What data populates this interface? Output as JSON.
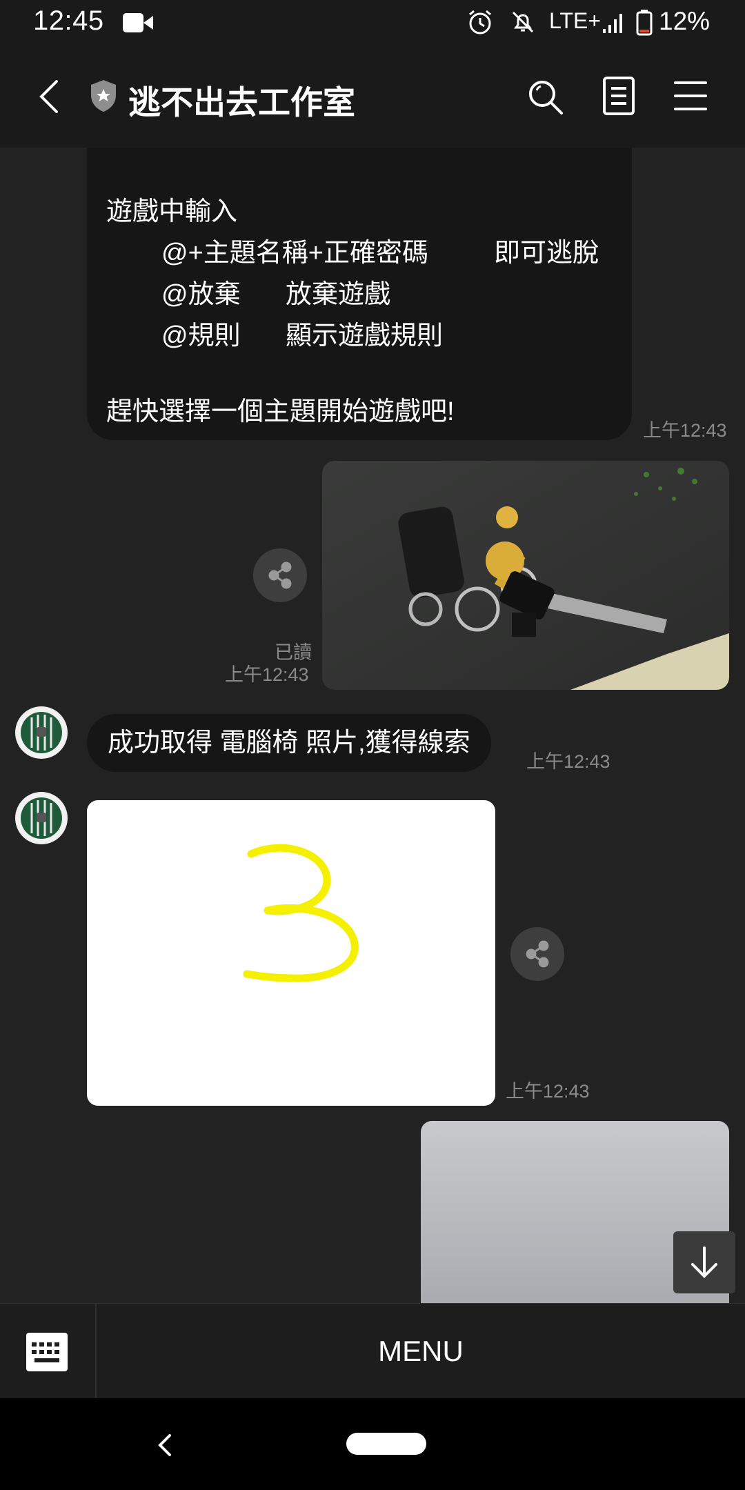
{
  "status_bar": {
    "time": "12:45",
    "network": "LTE+",
    "battery": "12%"
  },
  "header": {
    "title": "逃不出去工作室"
  },
  "messages": {
    "rules": {
      "lines": [
        "遊戲中輸入",
        "@+主題名稱+正確密碼",
        "即可逃脫",
        "@放棄",
        "放棄遊戲",
        "@規則",
        "顯示遊戲規則",
        "趕快選擇一個主題開始遊戲吧!"
      ],
      "timestamp": "上午12:43"
    },
    "photo_keys": {
      "read_status": "已讀",
      "timestamp": "上午12:43"
    },
    "success": {
      "text": "成功取得 電腦椅 照片,獲得線索",
      "timestamp": "上午12:43"
    },
    "photo_three": {
      "timestamp": "上午12:43"
    }
  },
  "bottom_bar": {
    "menu_label": "MENU"
  },
  "icons": {
    "back": "chevron-left-icon",
    "shield": "shield-star-icon",
    "search": "search-icon",
    "notes": "notes-icon",
    "menu": "hamburger-menu-icon",
    "share": "share-icon",
    "scroll_down": "arrow-down-icon",
    "keyboard": "keyboard-icon"
  },
  "colors": {
    "background": "#222222",
    "bubble": "#161616",
    "timestamp": "#8a8a8a",
    "drawing_yellow": "#f5ef00"
  }
}
